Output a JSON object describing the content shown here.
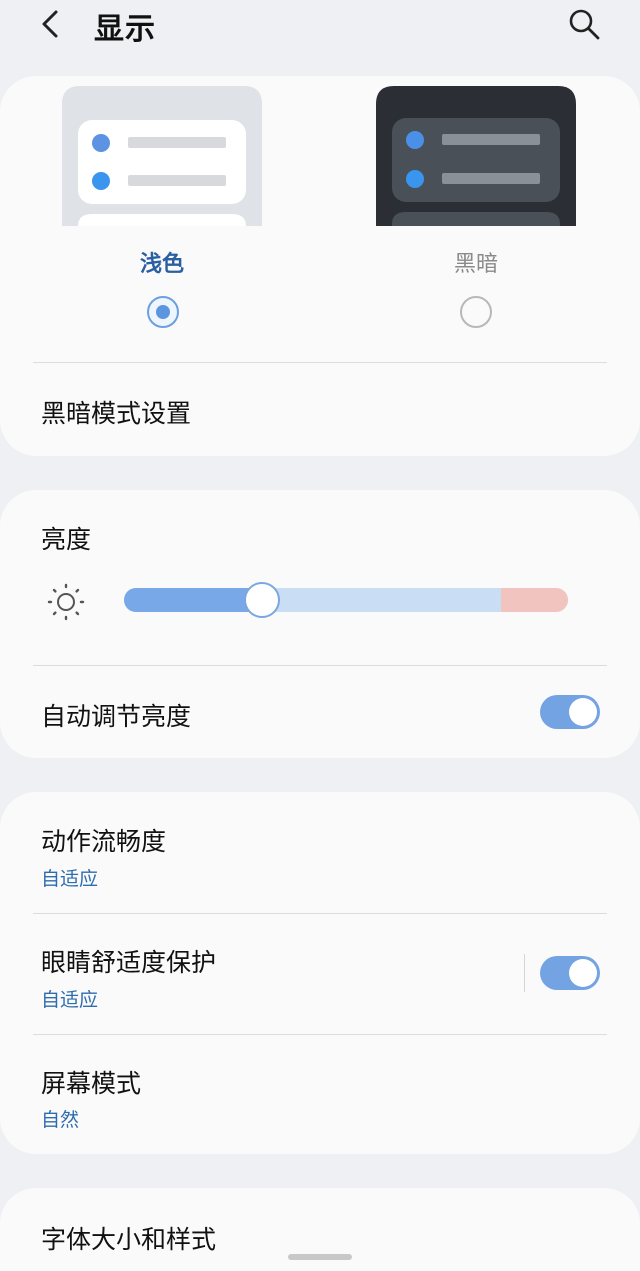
{
  "header": {
    "title": "显示",
    "back_icon": "chevron-left-icon",
    "search_icon": "search-icon"
  },
  "theme": {
    "light_label": "浅色",
    "dark_label": "黑暗",
    "selected": "light",
    "dark_mode_settings": "黑暗模式设置"
  },
  "brightness": {
    "title": "亮度",
    "icon": "sun-icon",
    "level": 0.31,
    "extra_brightness_zone": 0.15,
    "auto_label": "自动调节亮度",
    "auto_on": true
  },
  "motion": {
    "title": "动作流畅度",
    "value": "自适应"
  },
  "eye_comfort": {
    "title": "眼睛舒适度保护",
    "value": "自适应",
    "on": true
  },
  "screen_mode": {
    "title": "屏幕模式",
    "value": "自然"
  },
  "font": {
    "title": "字体大小和样式"
  },
  "colors": {
    "accent": "#73a3e3",
    "link": "#2e6cb0",
    "selected_label": "#2b5fa3",
    "background": "#eef0f3",
    "card": "#fafafa"
  }
}
